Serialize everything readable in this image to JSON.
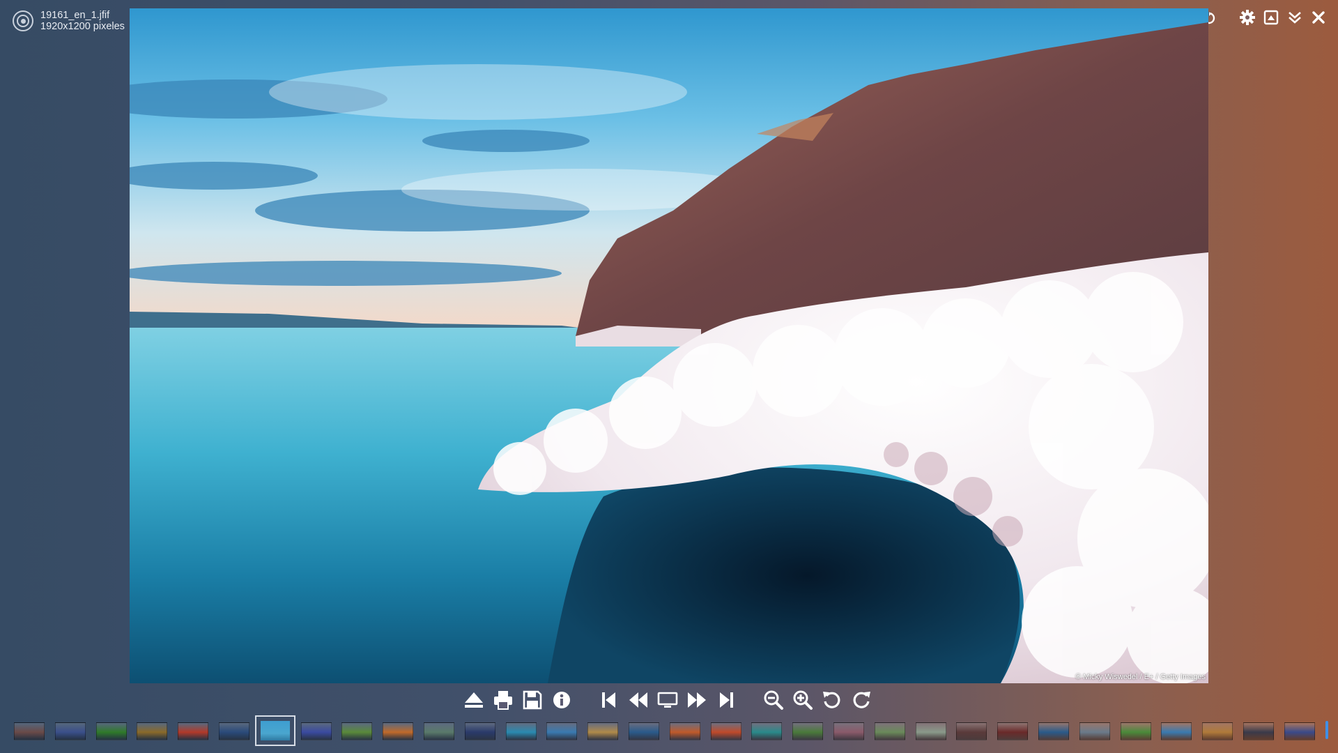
{
  "file": {
    "name": "19161_en_1.jfif",
    "dimensions": "1920x1200 pixeles"
  },
  "top_controls": {
    "rotation": "0°",
    "icons": [
      "rotate-reset-icon",
      "settings-icon",
      "window-icon",
      "collapse-icon",
      "close-icon"
    ]
  },
  "main_image": {
    "credit": "© Micky Wiswedel / E+ / Getty Images"
  },
  "toolbar": {
    "icons": [
      "eject-icon",
      "print-icon",
      "save-icon",
      "info-icon",
      "first-icon",
      "previous-icon",
      "slideshow-icon",
      "next-icon",
      "last-icon",
      "zoom-out-icon",
      "zoom-in-icon",
      "rotate-left-icon",
      "rotate-right-icon"
    ]
  },
  "thumbnails": {
    "selected_index": 6,
    "colors": [
      "#6a4a48",
      "#3a4f8a",
      "#2f7a2a",
      "#8a6a2a",
      "#b23a2a",
      "#2a4a7a",
      "#4aa6cf",
      "#3a4aa0",
      "#5a8a3a",
      "#c06a2a",
      "#5a7a6a",
      "#2a3a6a",
      "#2a8ab0",
      "#3a7ab0",
      "#b08a4a",
      "#2a5a8a",
      "#c05a2a",
      "#c04a2a",
      "#2a8a8a",
      "#4a7a3a",
      "#8a5a6a",
      "#6a8a5a",
      "#8a9a8a",
      "#5a3a3a",
      "#6a2a2a",
      "#2a5a8a",
      "#6a7a8a",
      "#4a8a3a",
      "#3a7ab0",
      "#b07a3a",
      "#3a3a4a",
      "#3a4a8a"
    ]
  }
}
